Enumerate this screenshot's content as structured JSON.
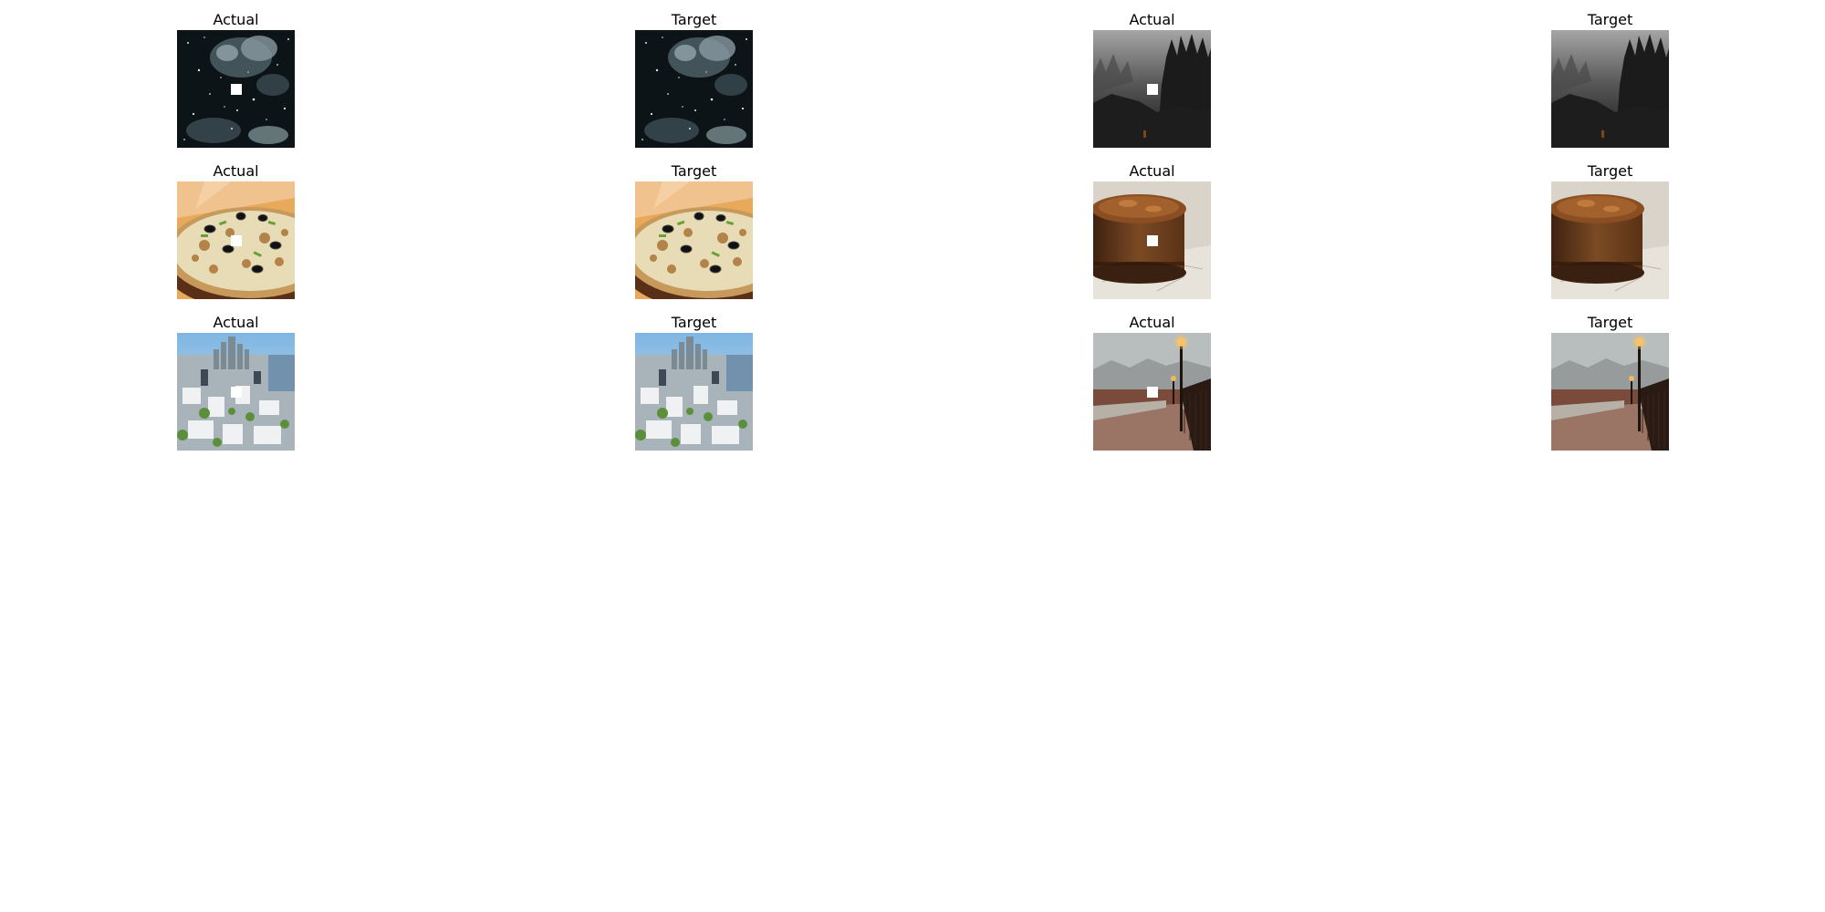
{
  "labels": {
    "actual": "Actual",
    "target": "Target"
  },
  "figure": {
    "rows": [
      {
        "left_pair": "space-snow",
        "right_pair": "foggy-forest"
      },
      {
        "left_pair": "pizza",
        "right_pair": "chocolate-cake"
      },
      {
        "left_pair": "city-aerial",
        "right_pair": "bridge-lamps"
      }
    ]
  }
}
